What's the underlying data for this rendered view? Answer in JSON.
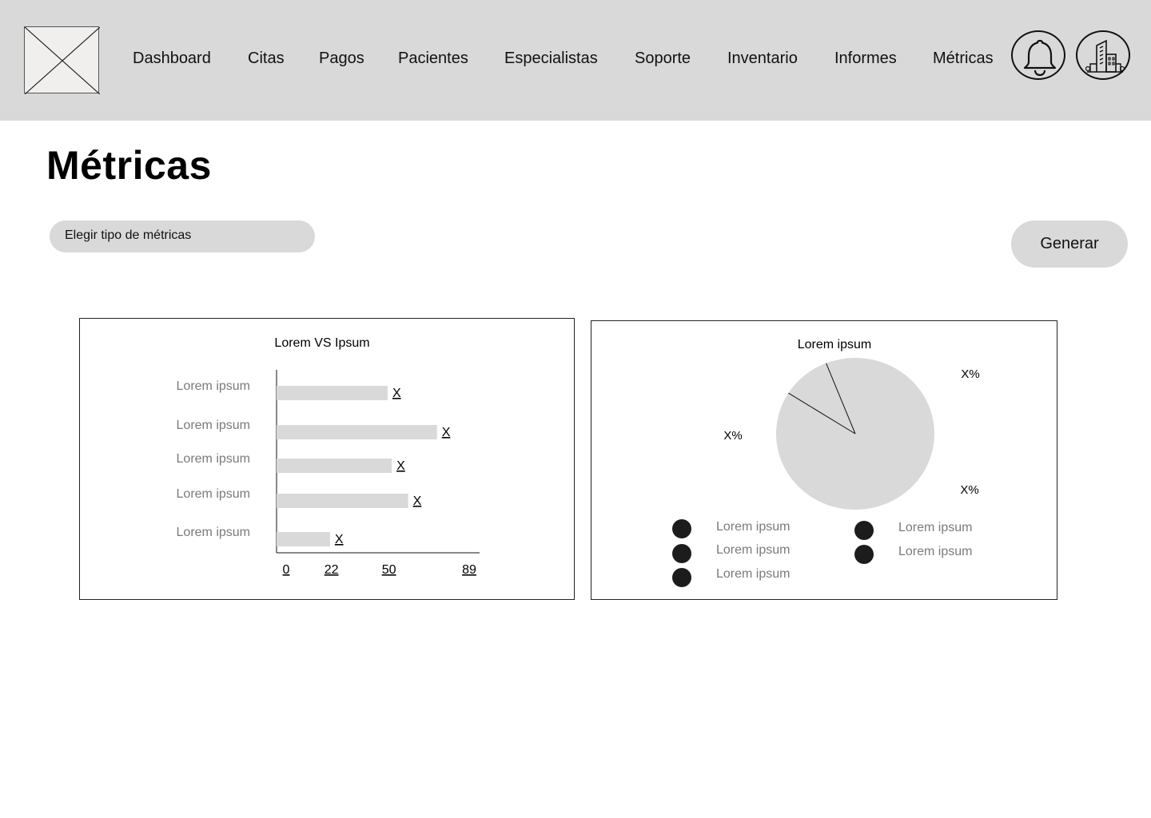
{
  "nav": {
    "items": [
      "Dashboard",
      "Citas",
      "Pagos",
      "Pacientes",
      "Especialistas",
      "Soporte",
      "Inventario",
      "Informes",
      "Métricas"
    ]
  },
  "header": {
    "logo_icon": "image-placeholder-icon",
    "notification_icon": "bell-icon",
    "organization_icon": "building-icon"
  },
  "page": {
    "title": "Métricas",
    "select_label": "Elegir tipo de métricas",
    "generate_label": "Generar"
  },
  "colors": {
    "header_bg": "#d9d9d9",
    "bar_fill": "#d9d9d9",
    "pie_fill": "#d9d9d9",
    "legend_dot": "#1c1c1c",
    "muted_text": "#7a7a7a"
  },
  "chart_data": [
    {
      "type": "bar",
      "orientation": "horizontal",
      "title": "Lorem VS Ipsum",
      "categories": [
        "Lorem ipsum",
        "Lorem ipsum",
        "Lorem ipsum",
        "Lorem ipsum",
        "Lorem ipsum"
      ],
      "values": [
        54,
        78,
        56,
        64,
        26
      ],
      "value_labels": [
        "X",
        "X",
        "X",
        "X",
        "X"
      ],
      "x_ticks": [
        0,
        22,
        50,
        89
      ],
      "xlim": [
        0,
        89
      ]
    },
    {
      "type": "pie",
      "title": "Lorem ipsum",
      "slice_labels": [
        "X%",
        "X%",
        "X%"
      ],
      "values": [
        84,
        10,
        6
      ],
      "legend": [
        "Lorem ipsum",
        "Lorem ipsum",
        "Lorem ipsum",
        "Lorem ipsum",
        "Lorem ipsum"
      ]
    }
  ]
}
